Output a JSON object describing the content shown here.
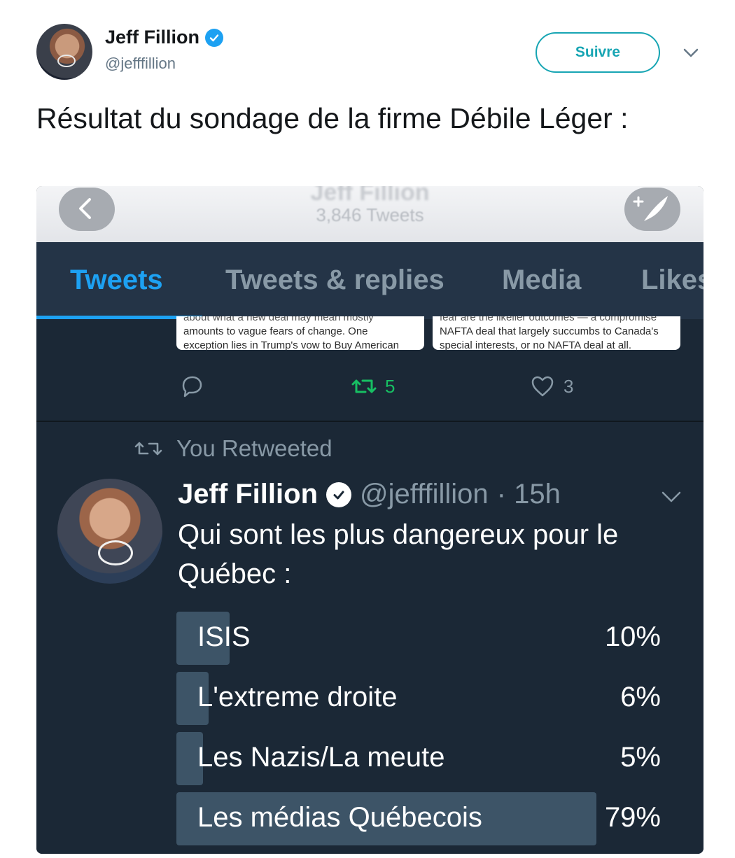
{
  "author": {
    "name": "Jeff Fillion",
    "handle": "@jefffillion"
  },
  "follow_label": "Suivre",
  "tweet_text": "Résultat du sondage  de la firme Débile Léger :",
  "screenshot": {
    "header": {
      "title": "Jeff Fillion",
      "tweets_count": "3,846 Tweets"
    },
    "tabs": [
      "Tweets",
      "Tweets & replies",
      "Media",
      "Likes"
    ],
    "active_tab": "Tweets",
    "cards": {
      "left": [
        "about what a new deal may mean mostly",
        "amounts to vague fears of change. One",
        "exception lies in Trump's vow to Buy American"
      ],
      "right": [
        "fear are the likelier outcomes — a compromise",
        "NAFTA deal that largely succumbs to Canada's",
        "special interests, or no NAFTA deal at all."
      ]
    },
    "actions": {
      "retweets": "5",
      "likes": "3"
    },
    "retweeted_label": "You Retweeted",
    "inner_tweet": {
      "name": "Jeff Fillion",
      "handle": "@jefffillion",
      "time": "· 15h",
      "text": "Qui sont les plus dangereux pour le Québec :"
    },
    "poll": [
      {
        "label": "ISIS",
        "percent": 10,
        "display": "10%"
      },
      {
        "label": "L'extreme droite",
        "percent": 6,
        "display": "6%"
      },
      {
        "label": "Les Nazis/La meute",
        "percent": 5,
        "display": "5%"
      },
      {
        "label": "Les médias Québecois",
        "percent": 79,
        "display": "79%"
      }
    ]
  },
  "colors": {
    "accent": "#1da1f2",
    "follow": "#17a5b3",
    "retweet": "#17bf63",
    "dark_bg": "#1b2836",
    "tab_bg": "#243447",
    "poll_bar": "#3d5467"
  }
}
